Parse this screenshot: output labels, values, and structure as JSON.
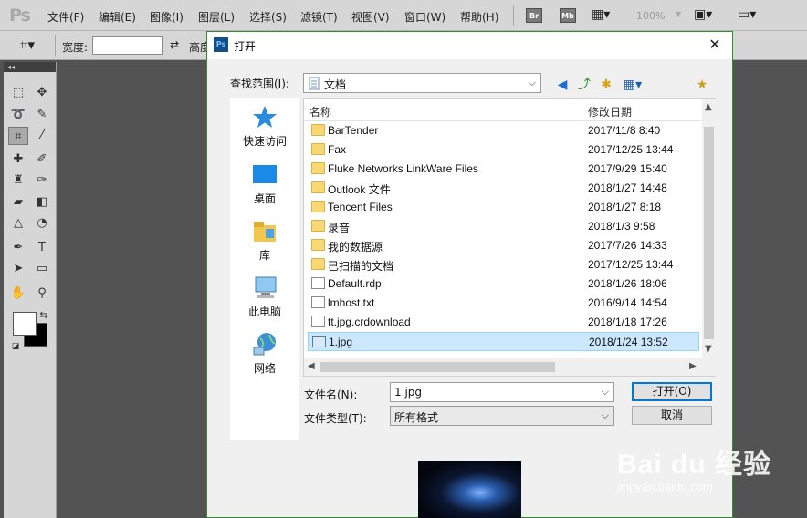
{
  "app": {
    "logo": "Ps"
  },
  "menubar": {
    "items": [
      "文件(F)",
      "编辑(E)",
      "图像(I)",
      "图层(L)",
      "选择(S)",
      "滤镜(T)",
      "视图(V)",
      "窗口(W)",
      "帮助(H)"
    ],
    "bridge_label": "Br",
    "minibridge_label": "Mb",
    "zoom": "100%"
  },
  "optionbar": {
    "width_label": "宽度:",
    "height_label": "高度"
  },
  "toolbox": {
    "collapse_glyph": "◂◂"
  },
  "dialog": {
    "title": "打开",
    "look_in_label": "查找范围(I):",
    "look_in_value": "文档",
    "places": [
      "快速访问",
      "桌面",
      "库",
      "此电脑",
      "网络"
    ],
    "columns": {
      "name": "名称",
      "date": "修改日期"
    },
    "files": [
      {
        "name": "BarTender",
        "date": "2017/11/8 8:40",
        "kind": "folder"
      },
      {
        "name": "Fax",
        "date": "2017/12/25 13:44",
        "kind": "folder"
      },
      {
        "name": "Fluke Networks LinkWare Files",
        "date": "2017/9/29 15:40",
        "kind": "folder"
      },
      {
        "name": "Outlook 文件",
        "date": "2018/1/27 14:48",
        "kind": "folder"
      },
      {
        "name": "Tencent Files",
        "date": "2018/1/27 8:18",
        "kind": "folder"
      },
      {
        "name": "录音",
        "date": "2018/1/3 9:58",
        "kind": "folder"
      },
      {
        "name": "我的数据源",
        "date": "2017/7/26 14:33",
        "kind": "folder"
      },
      {
        "name": "已扫描的文档",
        "date": "2017/12/25 13:44",
        "kind": "folder"
      },
      {
        "name": "Default.rdp",
        "date": "2018/1/26 18:06",
        "kind": "file"
      },
      {
        "name": "lmhost.txt",
        "date": "2016/9/14 14:54",
        "kind": "file"
      },
      {
        "name": "tt.jpg.crdownload",
        "date": "2018/1/18 17:26",
        "kind": "file"
      },
      {
        "name": "1.jpg",
        "date": "2018/1/24 13:52",
        "kind": "image",
        "selected": true
      }
    ],
    "filename_label": "文件名(N):",
    "filename_value": "1.jpg",
    "filetype_label": "文件类型(T):",
    "filetype_value": "所有格式",
    "open_button": "打开(O)",
    "cancel_button": "取消"
  },
  "watermark": {
    "brand": "Bai du 经验",
    "url": "jingyan.baidu.com"
  }
}
